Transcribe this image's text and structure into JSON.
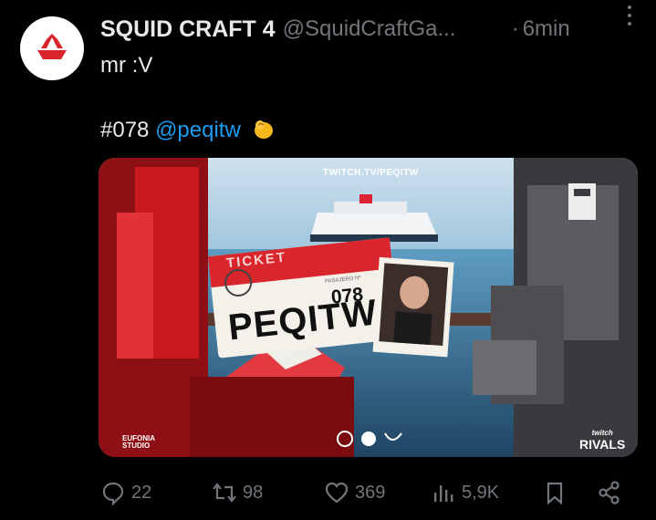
{
  "tweet": {
    "author_name": "SQUID CRAFT 4",
    "author_handle": "@SquidCraftGa...",
    "separator": "·",
    "time": "6min",
    "text_line1": "mr :V",
    "text_line2_prefix": "#078",
    "mention": "@peqitw",
    "emoji": "pinching-hand-emoji"
  },
  "media": {
    "twitch_url": "TWITCH.TV/PEQITW",
    "ticket_label": "TICKET",
    "ticket_passenger_label": "PASAJERO Nº",
    "ticket_number": "078",
    "ticket_name": "PEQITW",
    "studio_logo": "EUFONIA",
    "studio_sub": "STUDIO",
    "sponsor_top": "twitch",
    "sponsor_bottom": "RIVALS"
  },
  "actions": {
    "replies": "22",
    "retweets": "98",
    "likes": "369",
    "views": "5,9K"
  },
  "colors": {
    "background": "#000000",
    "text": "#e7e9ea",
    "secondary": "#71767b",
    "link": "#1d9bf0",
    "brand_red": "#d9262c"
  }
}
